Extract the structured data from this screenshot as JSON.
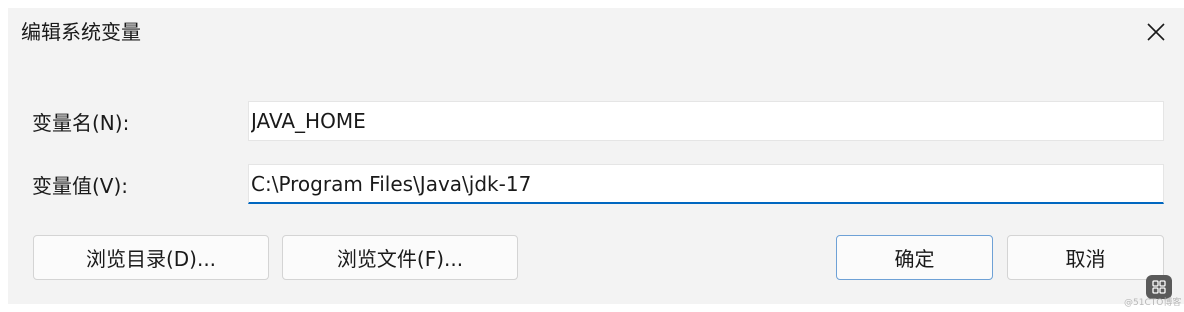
{
  "dialog": {
    "title": "编辑系统变量"
  },
  "fields": {
    "name_label": "变量名(N):",
    "name_value": "JAVA_HOME",
    "value_label": "变量值(V):",
    "value_value": "C:\\Program Files\\Java\\jdk-17"
  },
  "buttons": {
    "browse_dir": "浏览目录(D)...",
    "browse_file": "浏览文件(F)...",
    "ok": "确定",
    "cancel": "取消"
  },
  "watermark": {
    "text": "@51CTO博客"
  },
  "colors": {
    "accent": "#0067c0",
    "background": "#f3f3f3"
  }
}
